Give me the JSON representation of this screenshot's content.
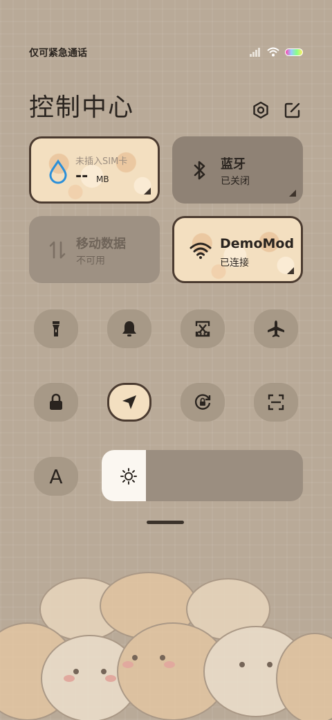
{
  "status_bar": {
    "text": "仅可紧急通话"
  },
  "header": {
    "title": "控制中心"
  },
  "tiles": {
    "data_usage": {
      "label": "未插入SIM卡",
      "value": "--",
      "unit": "MB"
    },
    "bluetooth": {
      "title": "蓝牙",
      "status": "已关闭"
    },
    "mobile_data": {
      "title": "移动数据",
      "status": "不可用"
    },
    "wifi": {
      "title": "DemoMod",
      "status": "已连接"
    }
  },
  "quick_toggles": [
    {
      "icon": "flashlight-icon",
      "active": false
    },
    {
      "icon": "bell-icon",
      "active": false
    },
    {
      "icon": "screenshot-icon",
      "active": false
    },
    {
      "icon": "airplane-icon",
      "active": false
    },
    {
      "icon": "lock-icon",
      "active": false
    },
    {
      "icon": "location-icon",
      "active": true
    },
    {
      "icon": "rotation-lock-icon",
      "active": false
    },
    {
      "icon": "scan-icon",
      "active": false
    },
    {
      "icon": "font-icon",
      "active": false
    }
  ],
  "brightness": {
    "level": 0.22
  },
  "font_toggle": {
    "label": "A"
  },
  "colors": {
    "background": "#b9aa98",
    "tile_dark": "#8f8275",
    "tile_cute": "#f3dfc0",
    "data_blue": "#2a8fd9"
  }
}
